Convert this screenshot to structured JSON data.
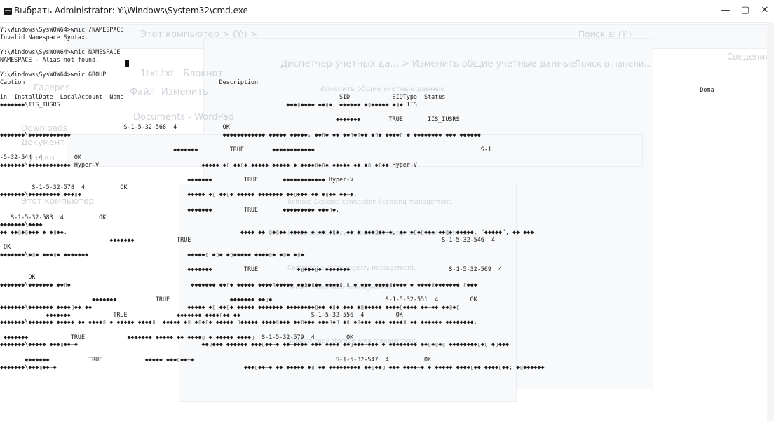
{
  "window": {
    "title": "Выбрать Administrator: Y:\\Windows\\System32\\cmd.exe",
    "minimize": "—",
    "maximize": "▢",
    "close": "✕"
  },
  "background_windows": {
    "explorer_path": "Этот компьютер  >  (Y:)  >",
    "search": "Поиск в: (Y:)",
    "details": "Сведения",
    "control_panel_path": "Диспетчер учетных да...  >  Изменить общие учетные данные",
    "control_panel_search": "Поиск в панели...",
    "change_creds_header": "Изменить общие учетные данные",
    "notepad_title": "1txt.txt - Блокнот",
    "notepad_menu": [
      "Файл",
      "Изменить"
    ],
    "wordpad_title": "Documents - WordPad",
    "sidebar": [
      "Галерея",
      "Downloads",
      "Документ",
      "Музыка",
      "Этот компьютер"
    ],
    "desc_rows": [
      "Remote Desktop connection licensing management.",
      "Formulates CPU cycle load balancing for virtual machines.",
      "Computer system registry management.",
      "Server information management.",
      "Shadow copy storage area management."
    ]
  },
  "console": {
    "lines": [
      "Y:\\Windows\\SysWOW64>wmic /NAMESPACE",
      "Invalid Namespace Syntax.",
      "",
      "Y:\\Windows\\SysWOW64>wmic NAMESPACE",
      "NAMESPACE - Alias not found.",
      "",
      "Y:\\Windows\\SysWOW64>wmic GROUP",
      "Caption                                                       Description",
      "                                                                                                                                                                                                      Doma",
      "in  InstallDate  LocalAccount  Name                                                             SID            SIDType  Status",
      "◆◆◆◆◆◆◆\\IIS_IUSRS                                                                ◆◆◆▯◆◆◆◆ ◆◆▯◆, ◆◆◆◆◆◆ ◆▯◆◆◆◆◆ ◆▯◆ IIS.",
      "",
      "                                                                                               ◆◆◆◆◆◆◆        TRUE       IIS_IUSRS",
      "                                   S-1-5-32-568  4             OK",
      "◆◆◆◆◆◆◆\\◆◆◆◆◆◆◆◆◆◆◆◆                                           ◆◆◆◆◆◆◆◆◆◆◆◆ ◆◆◆◆◆ ◆◆◆◆◆, ◆◆▯◆ ◆◆ ◆◆▯◆▯◆◆ ◆▯◆ ◆◆◆◆▯ ◆ ◆◆◆◆◆◆◆◆ ◆◆◆ ◆◆◆◆◆◆",
      "",
      "                                                 ◆◆◆◆◆◆◆         TRUE        ◆◆◆◆◆◆◆◆◆◆◆◆                                               S-1",
      "-5-32-544  4         OK",
      "◆◆◆◆◆◆◆\\◆◆◆◆◆◆◆◆◆◆◆◆ Hyper-V                             ◆◆◆◆◆ ◆▯ ◆◆▯◆ ◆◆◆◆◆ ◆◆◆◆◆ ◆ ◆◆◆◆▯◆▯◆ ◆◆◆◆◆ ◆◆ ◆▯ ◆▯◆◆ Hyper-V.",
      "",
      "                                                     ◆◆◆◆◆◆◆         TRUE       ◆◆◆◆◆◆◆◆◆◆◆◆ Hyper-V",
      "         S-1-5-32-578  4          OK",
      "◆◆◆◆◆◆◆\\◆◆◆◆◆◆◆◆◆ ◆◆◆▯◆.                             ◆◆◆◆◆ ◆▯ ◆◆▯◆ ◆◆◆◆◆ ◆◆◆◆◆◆◆ ◆◆▯◆◆◆ ◆◆ ◆▯◆◆ ◆◆–◆.",
      "",
      "                                                     ◆◆◆◆◆◆◆         TRUE       ◆◆◆◆◆◆◆◆◆ ◆◆◆▯◆.",
      "   S-1-5-32-583  4          OK",
      "◆◆◆◆◆◆◆\\◆◆◆◆",
      "◆◆ ◆◆▯◆▯◆◆◆ ◆ ◆▯◆◆.                                                 ◆◆◆◆ ◆◆ ▯◆▯◆◆ ◆◆◆◆◆ ◆ ◆◆ ◆▯◆, ◆◆ ◆ ◆◆◆▯◆◆–◆, ◆◆ ◆▯◆▯◆◆◆ ◆◆▯◆ ◆◆◆◆◆, \"◆◆◆◆◆\", ◆◆ ◆◆◆",
      "                               ◆◆◆◆◆◆◆            TRUE                                                                       S-1-5-32-546  4",
      " OK",
      "◆◆◆◆◆◆◆\\◆▯◆ ◆◆◆▯◆ ◆◆◆◆◆◆◆                            ◆◆◆◆◆▯ ◆▯◆ ◆▯◆◆◆◆◆ ◆◆◆◆▯◆ ◆▯◆ ◆▯◆.",
      "",
      "                                                     ◆◆◆◆◆◆◆         TRUE           ◆▯◆◆◆▯◆ ◆◆◆◆◆◆◆                            S-1-5-32-569  4",
      "        OK",
      "◆◆◆◆◆◆◆\\◆◆◆◆◆◆◆ ◆◆▯◆                                  ◆◆◆◆◆◆◆ ◆◆▯◆ ◆◆◆◆◆ ◆◆◆◆▯◆◆◆◆◆ ◆◆▯◆▯◆◆ ◆◆◆◆▯ ▯ ◆ ◆◆◆ ◆◆◆◆▯◆◆◆◆ ◆ ◆◆◆◆▯◆◆◆◆◆◆◆ ▯◆◆◆",
      "",
      "                          ◆◆◆◆◆◆◆           TRUE                 ◆◆◆◆◆◆◆ ◆◆▯◆                                S-1-5-32-551  4         OK",
      "◆◆◆◆◆◆◆\\◆◆◆◆◆◆◆ ◆◆◆◆▯◆◆ ◆◆                           ◆◆◆◆◆ ◆▯ ◆◆▯◆ ◆◆◆◆◆ ◆◆◆◆◆◆◆ ◆◆◆◆◆◆◆◆▯◆◆ ◆▯◆ ◆◆◆ ◆▯◆◆◆◆◆ ◆◆◆◆▯◆◆◆◆ ◆◆–◆◆ ◆◆▯◆▯",
      "             ◆◆◆◆◆◆◆            TRUE              ◆◆◆◆◆◆◆ ◆◆◆◆▯◆◆ ◆◆                    S-1-5-32-556  4         OK",
      "◆◆◆◆◆◆◆\\◆◆◆◆◆◆◆ ◆◆◆◆◆ ◆◆ ◆◆◆◆▯ ◆ ◆◆◆◆◆ ◆◆◆◆▯  ◆◆◆◆◆ ◆▯ ◆▯◆▯◆ ◆◆◆◆◆ ▯◆◆◆◆◆ ◆◆◆◆▯◆◆◆ ◆◆▯◆◆◆ ◆◆◆▯◆▯ ◆▯ ◆▯◆◆◆ ◆◆◆ ◆◆◆◆▯ ◆◆ ◆◆◆◆◆◆ ◆◆◆◆◆◆◆◆.",
      "",
      " ◆◆◆◆◆◆◆            TRUE            ◆◆◆◆◆◆◆ ◆◆◆◆◆ ◆◆ ◆◆◆◆▯ ◆ ◆◆◆◆◆ ◆◆◆◆▯  S-1-5-32-579  4         OK",
      "◆◆◆◆◆◆◆\\◆◆◆◆◆ ◆◆◆▯◆◆–◆                                   ◆◆▯◆◆◆ ◆◆◆◆◆◆ ◆◆◆▯◆◆–◆ ◆◆–◆◆◆◆ ◆◆◆ ◆◆◆◆ ◆◆▯◆◆◆–◆◆◆ ◆ ◆◆◆◆◆◆◆◆ ◆◆▯◆▯◆▯ ◆◆◆◆◆◆◆◆▯◆▯ ◆▯◆◆◆",
      "",
      "       ◆◆◆◆◆◆◆           TRUE            ◆◆◆◆◆ ◆◆◆▯◆◆–◆                                        S-1-5-32-547  4          OK",
      "◆◆◆◆◆◆◆\\◆◆◆▯◆◆–◆                                                     ◆◆◆▯◆◆–◆ ◆◆ ◆◆◆◆◆ ◆▯ ◆◆ ◆◆◆◆◆◆◆◆◆ ◆◆▯◆◆▯ ◆◆◆ ◆◆◆◆–◆ ◆ ◆◆◆◆◆ ◆◆◆◆▯◆◆ ◆◆◆◆▯◆◆; ◆▯◆◆◆◆◆◆"
    ]
  }
}
